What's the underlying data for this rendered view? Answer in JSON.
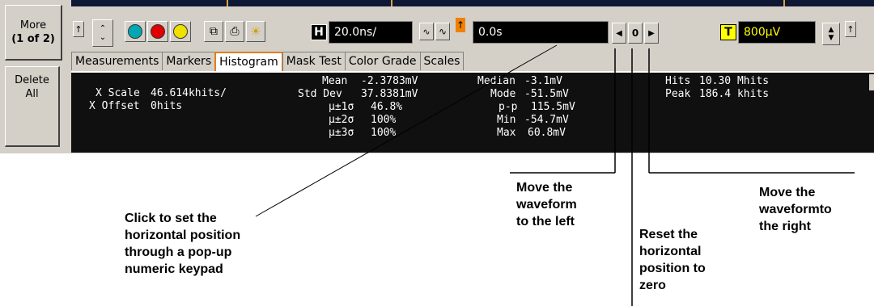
{
  "softkeys": {
    "more_line1": "More",
    "more_line2": "(1 of 2)",
    "delete_line1": "Delete",
    "delete_line2": "All"
  },
  "toolbar": {
    "arrow_up": "↑",
    "circles": [
      {
        "name": "teal",
        "color": "#00a8b4"
      },
      {
        "name": "red",
        "color": "#e00000"
      },
      {
        "name": "yellow",
        "color": "#f0e000"
      }
    ],
    "h_label": "H",
    "horizontal_scale": "20.0ns/",
    "horizontal_position": "0.0s",
    "marker": "↑",
    "nav_left": "◀",
    "nav_zero": "0",
    "nav_right": "▶",
    "t_label": "T",
    "trigger_level": "800µV",
    "trigger_marker": "↑"
  },
  "tabs": [
    "Measurements",
    "Markers",
    "Histogram",
    "Mask Test",
    "Color Grade",
    "Scales"
  ],
  "active_tab": "Histogram",
  "histogram": {
    "x_scale_label": "X Scale",
    "x_scale_value": "46.614khits/",
    "x_offset_label": "X Offset",
    "x_offset_value": "0hits",
    "mean_label": "Mean",
    "mean_value": "-2.3783mV",
    "stddev_label": "Std Dev",
    "stddev_value": "37.8381mV",
    "s1_label": "µ±1σ",
    "s1_value": "46.8%",
    "s2_label": "µ±2σ",
    "s2_value": "100%",
    "s3_label": "µ±3σ",
    "s3_value": "100%",
    "median_label": "Median",
    "median_value": "-3.1mV",
    "mode_label": "Mode",
    "mode_value": "-51.5mV",
    "pp_label": "p-p",
    "pp_value": "115.5mV",
    "min_label": "Min",
    "min_value": "-54.7mV",
    "max_label": "Max",
    "max_value": "60.8mV",
    "hits_label": "Hits",
    "hits_value": "10.30 Mhits",
    "peak_label": "Peak",
    "peak_value": "186.4 khits"
  },
  "callouts": {
    "keypad": [
      "Click to set the",
      "horizontal position",
      "through a pop-up",
      "numeric keypad"
    ],
    "left": [
      "Move the",
      "waveform",
      "to the left"
    ],
    "reset": [
      "Reset the",
      "horizontal",
      "position to",
      "zero"
    ],
    "right": [
      "Move the",
      "waveformto",
      "the right"
    ]
  },
  "colors": {
    "panel_bg": "#d4d0c8",
    "display_bg": "#101010",
    "active_tab_border": "#e08020",
    "trigger_text": "#ffff00",
    "marker_orange": "#f08000"
  }
}
